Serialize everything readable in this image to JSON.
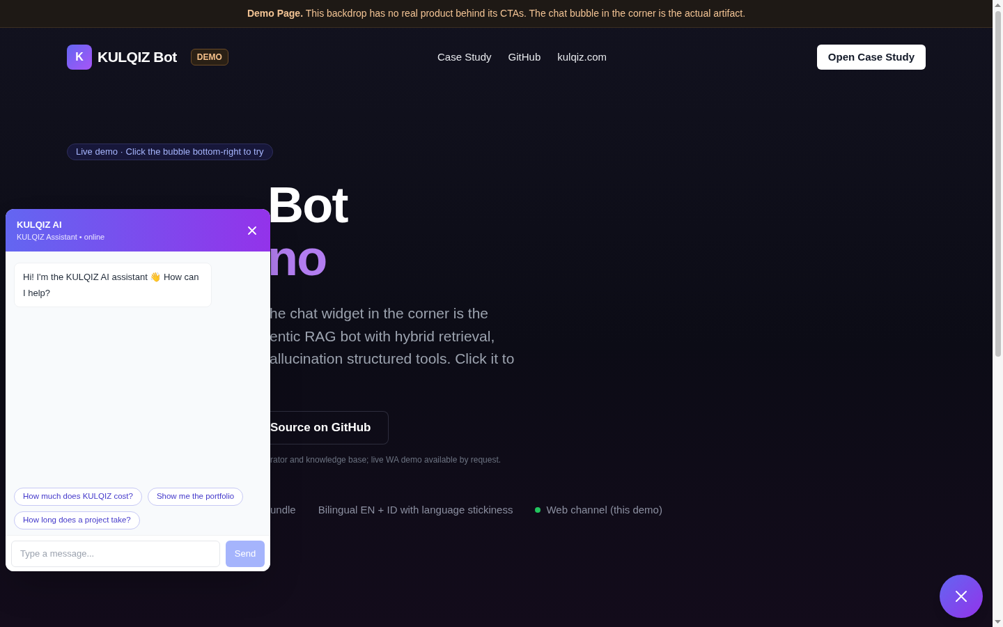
{
  "banner": {
    "text": "**Demo Page.** This backdrop has no real product behind its CTAs. The chat bubble in the corner is the actual artifact."
  },
  "brand": {
    "logo_letter": "K",
    "name": "KULQIZ Bot",
    "badge": "DEMO"
  },
  "nav": {
    "links": [
      "Case Study",
      "GitHub",
      "kulqiz.com"
    ],
    "cta": "Open Case Study"
  },
  "hero": {
    "tag": "Live demo · Click the bubble bottom-right to try",
    "title_line_1": "Bot",
    "title_line_2": "no",
    "paragraph_lines": [
      "he chat widget in the corner is the",
      "entic RAG bot with hybrid retrieval,",
      "allucination structured tools. Click it to"
    ],
    "button": "Source on GitHub",
    "note": "rator and knowledge base; live WA demo available by request.",
    "features": [
      {
        "label": "undle",
        "dot": false
      },
      {
        "label": "Bilingual EN + ID with language stickiness",
        "dot": false
      },
      {
        "label": "Web channel (this demo)",
        "dot": true
      }
    ]
  },
  "chat": {
    "title": "KULQIZ AI",
    "subtitle": "KULQIZ Assistant • online",
    "messages": [
      {
        "kind": "bot",
        "text": "Hi! I'm the KULQIZ AI assistant 👋 How can I help?"
      }
    ],
    "suggestions": [
      "How much does KULQIZ cost?",
      "Show me the portfolio",
      "How long does a project take?"
    ],
    "input": {
      "placeholder": "Type a message..."
    },
    "send": "Send",
    "send_disabled": true
  },
  "fab": {
    "open": true
  }
}
